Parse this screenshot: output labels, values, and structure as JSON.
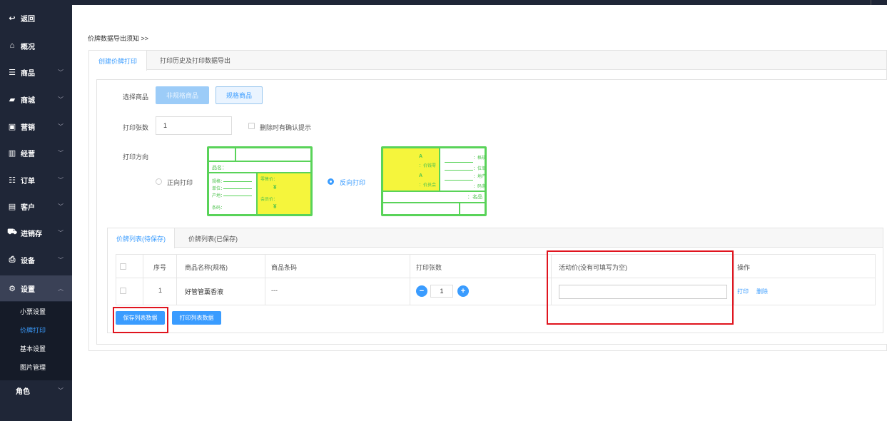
{
  "sidebar": {
    "back": "返回",
    "items": [
      {
        "label": "概况",
        "icon": "home-icon"
      },
      {
        "label": "商品",
        "icon": "list-icon"
      },
      {
        "label": "商城",
        "icon": "shop-bag-icon"
      },
      {
        "label": "营销",
        "icon": "gift-icon"
      },
      {
        "label": "经营",
        "icon": "bar-chart-icon"
      },
      {
        "label": "订单",
        "icon": "order-list-icon"
      },
      {
        "label": "客户",
        "icon": "id-card-icon"
      },
      {
        "label": "进销存",
        "icon": "truck-icon"
      },
      {
        "label": "设备",
        "icon": "printer-icon"
      },
      {
        "label": "设置",
        "icon": "gear-icon"
      }
    ],
    "sub_items": [
      "小票设置",
      "价牌打印",
      "基本设置",
      "图片管理"
    ],
    "role": "角色"
  },
  "notice": "价牌数据导出须知 >>",
  "tabs": [
    "创建价牌打印",
    "打印历史及打印数据导出"
  ],
  "form": {
    "select_goods_label": "选择商品",
    "non_spec_button": "非规格商品",
    "spec_button": "规格商品",
    "print_count_label": "打印张数",
    "print_count_value": "1",
    "confirm_delete_label": "删除时有确认提示",
    "direction_label": "打印方向",
    "forward_print": "正向打印",
    "reverse_print": "反向打印"
  },
  "preview_forward": {
    "name_label": "品名：",
    "field1": "规格：",
    "field2": "单位：",
    "field3": "产地：",
    "field4": "条码：",
    "retail_label": "零售价：",
    "member_label": "会员价：",
    "yen": "¥"
  },
  "preview_reverse": {
    "a1": "A",
    "a1_sub": "：价钱零",
    "a2": "A",
    "a2_sub": "：价员会",
    "r1": "：格规",
    "r2": "：位单",
    "r3": "：地产",
    "r4": "：码条",
    "name": "：名品"
  },
  "list": {
    "tabs": [
      "价牌列表(待保存)",
      "价牌列表(已保存)"
    ],
    "headers": [
      "序号",
      "商品名称(规格)",
      "商品条码",
      "打印张数",
      "活动价(没有可填写为空)",
      "操作"
    ],
    "rows": [
      {
        "index": "1",
        "name": "好管管薰香液",
        "barcode": "---",
        "count": "1",
        "actions": [
          "打印",
          "删除"
        ]
      }
    ],
    "save_button": "保存列表数据",
    "print_button": "打印列表数据"
  },
  "colors": {
    "accent": "#3a9cff",
    "sidebar": "#1f2637",
    "highlight": "#e0141e",
    "preview_green": "#59d359",
    "preview_yellow": "#f5f53c"
  }
}
